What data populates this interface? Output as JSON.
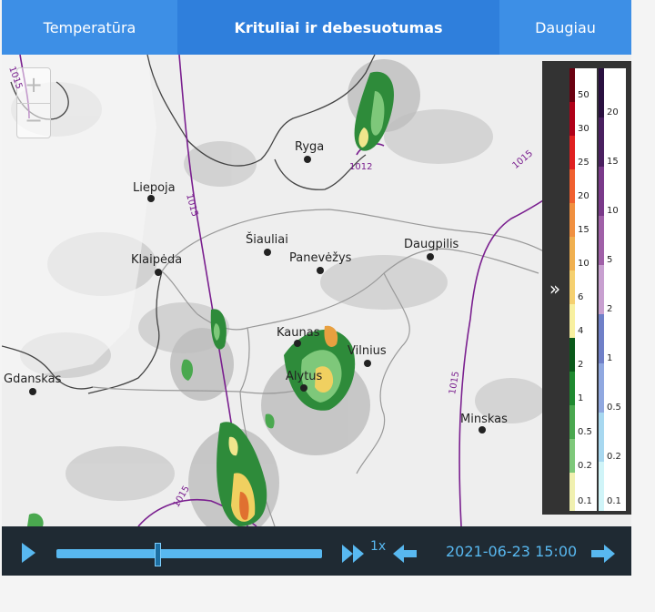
{
  "tabs": [
    {
      "label": "Temperatūra"
    },
    {
      "label": "Krituliai ir debesuotumas"
    },
    {
      "label": "Daugiau"
    }
  ],
  "map": {
    "zoom_in": "+",
    "zoom_out": "−",
    "cities": [
      {
        "name": "Ryga"
      },
      {
        "name": "Liepoja"
      },
      {
        "name": "Šiauliai"
      },
      {
        "name": "Panevėžys"
      },
      {
        "name": "Daugpilis"
      },
      {
        "name": "Klaipėda"
      },
      {
        "name": "Kaunas"
      },
      {
        "name": "Vilnius"
      },
      {
        "name": "Alytus"
      },
      {
        "name": "Gdanskas"
      },
      {
        "name": "Minskas"
      }
    ],
    "isobars": [
      "1015",
      "1012",
      "1015",
      "1015",
      "1015",
      "1015"
    ]
  },
  "legend": {
    "expand": "»",
    "rain_labels": [
      "50",
      "30",
      "25",
      "20",
      "15",
      "10",
      "6",
      "4",
      "2",
      "1",
      "0.5",
      "0.2",
      "0.1"
    ],
    "snow_labels": [
      "20",
      "15",
      "10",
      "5",
      "2",
      "1",
      "0.5",
      "0.2",
      "0.1"
    ]
  },
  "controls": {
    "speed": "1x",
    "datetime": "2021-06-23 15:00",
    "progress": 0.38
  }
}
